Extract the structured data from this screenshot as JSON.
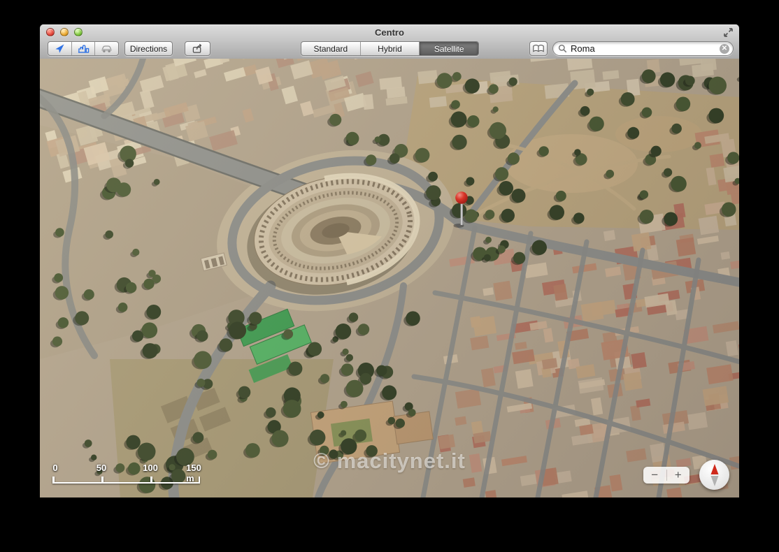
{
  "window": {
    "title": "Centro"
  },
  "titlebar": {
    "traffic_lights": [
      "close",
      "minimize",
      "zoom"
    ],
    "fullscreen_icon": "fullscreen-arrows-icon"
  },
  "toolbar": {
    "view_controls": {
      "location_icon": "location-arrow-icon",
      "buildings_icon": "3d-buildings-icon",
      "traffic_icon": "traffic-car-icon"
    },
    "directions_label": "Directions",
    "share_icon": "share-icon",
    "bookmarks_icon": "bookmarks-book-icon",
    "map_modes": [
      {
        "label": "Standard",
        "selected": false
      },
      {
        "label": "Hybrid",
        "selected": false
      },
      {
        "label": "Satellite",
        "selected": true
      }
    ]
  },
  "search": {
    "value": "Roma",
    "placeholder": "",
    "magnifier_icon": "search-icon",
    "clear_icon": "clear-circle-icon"
  },
  "map": {
    "description": "3D satellite view of central Rome with the Colosseum and a red dropped pin",
    "watermark": "© macitynet.it",
    "scale_ticks": [
      "0",
      "50",
      "100",
      "150 m"
    ],
    "zoom_out": "−",
    "zoom_in": "+",
    "compass_icon": "compass-needle-icon",
    "pin_icon": "red-map-pin-icon"
  },
  "colors": {
    "accent_blue": "#2f72e4",
    "selected_segment": "#6a6a6a",
    "pin_red": "#e02b20",
    "toolbar_top": "#dcdcdc",
    "toolbar_bottom": "#a9a9a9",
    "map_ground": "#b5a58b",
    "tree_green": "#3c4826",
    "road_gray": "#8f8f88"
  }
}
